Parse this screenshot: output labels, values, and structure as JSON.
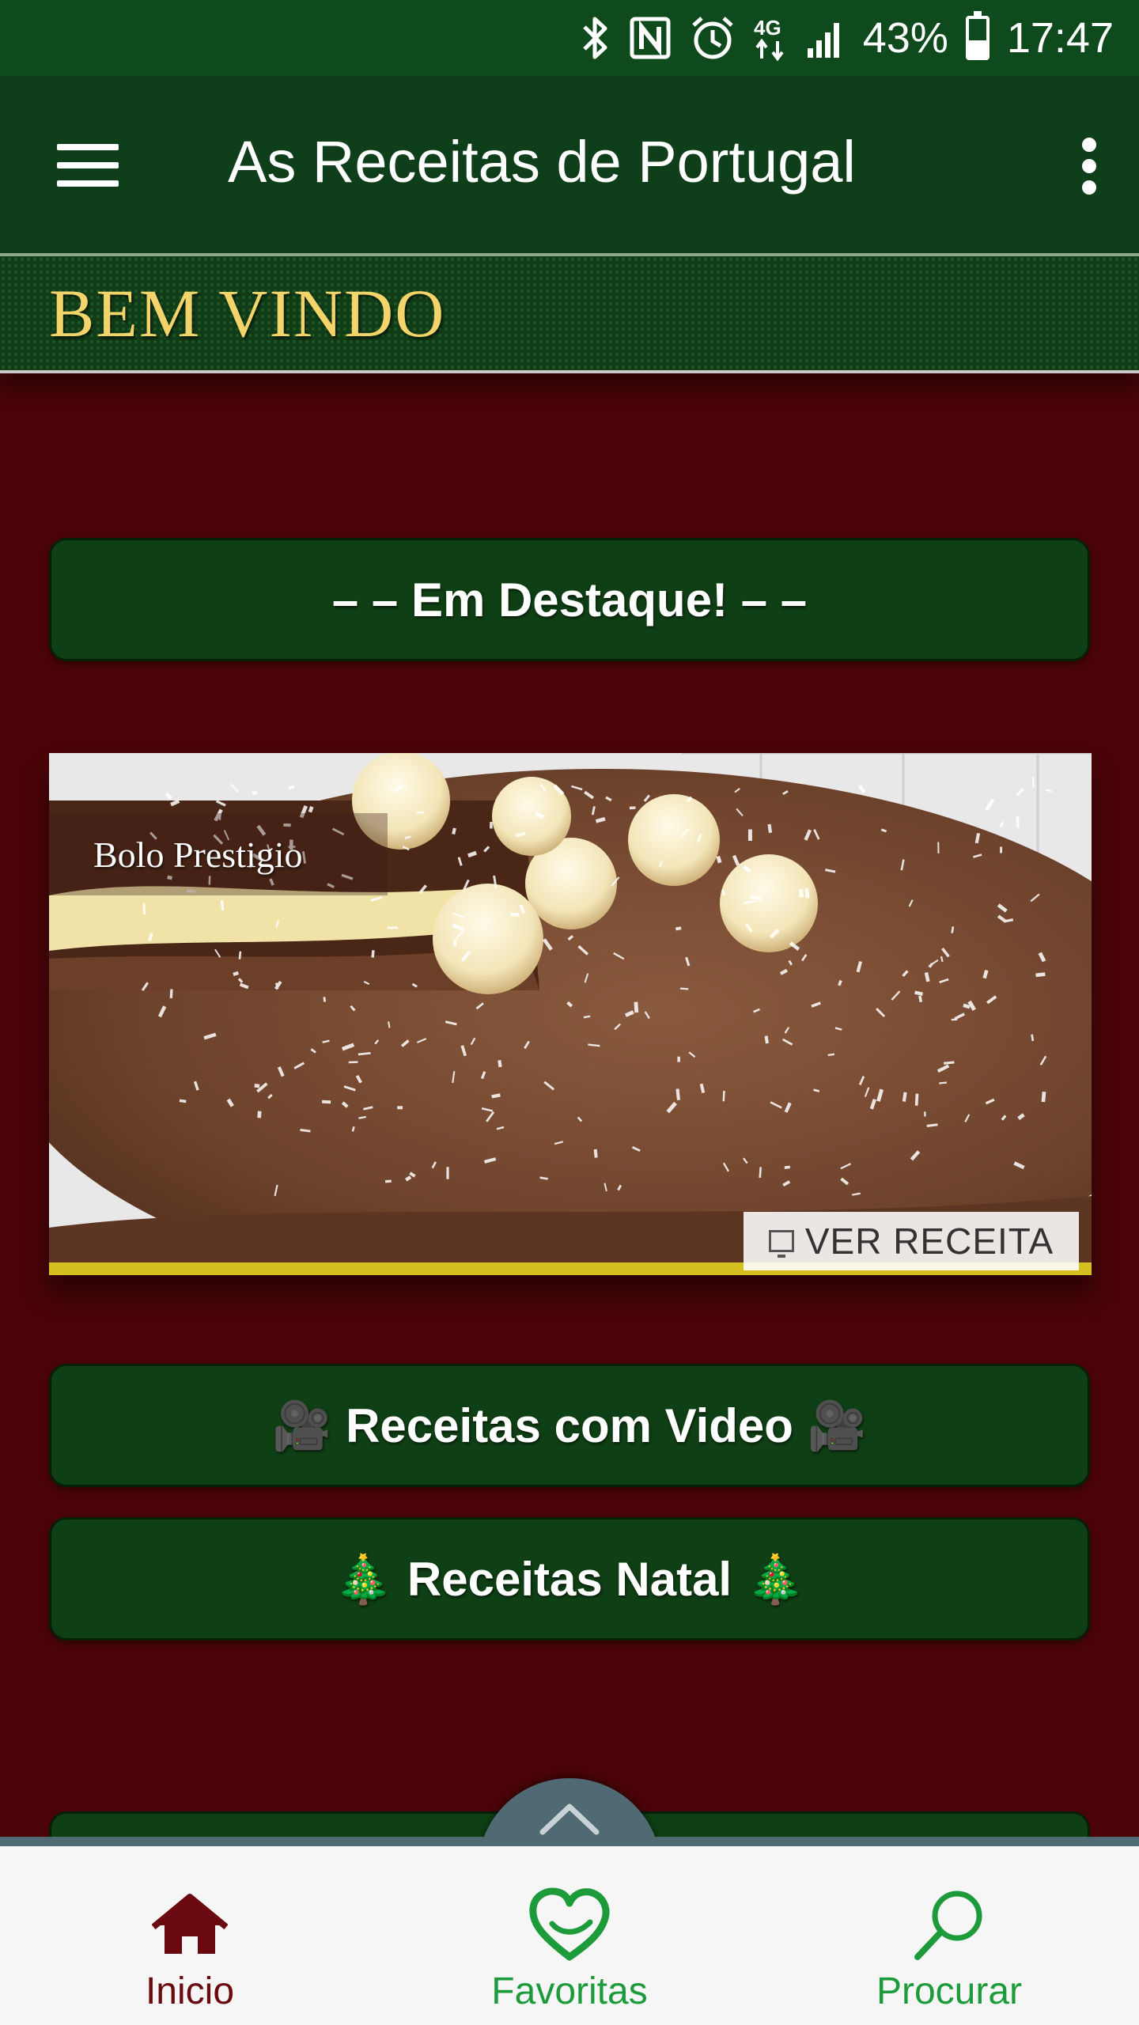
{
  "status_bar": {
    "battery": "43%",
    "battery_level": 0.43,
    "time": "17:47",
    "network": "4G"
  },
  "app_bar": {
    "title": "As Receitas de Portugal",
    "menu_icon": "hamburger-menu-icon",
    "overflow_icon": "more-vertical-icon"
  },
  "welcome": {
    "text": "BEM VINDO"
  },
  "featured_header": {
    "label": "– – Em Destaque! – –"
  },
  "featured": {
    "name": "Bolo Prestigio",
    "cta": "VER RECEITA"
  },
  "buttons": {
    "video": {
      "emoji": "🎥",
      "label": "Receitas com Video"
    },
    "natal": {
      "emoji": "🎄",
      "label": "Receitas Natal"
    }
  },
  "bottom_nav": {
    "items": [
      {
        "label": "Inicio",
        "icon": "home-icon",
        "color": "#6a0a10"
      },
      {
        "label": "Favoritas",
        "icon": "heart-icon",
        "color": "#1d9b3a"
      },
      {
        "label": "Procurar",
        "icon": "search-icon",
        "color": "#1d9b3a"
      }
    ]
  },
  "colors": {
    "background": "#4a0408",
    "status_bar": "#0f4a1c",
    "app_bar": "#0f3f1a",
    "button": "#0f3f14",
    "welcome_text": "#f3d46b",
    "nav_bar": "#506a74"
  }
}
